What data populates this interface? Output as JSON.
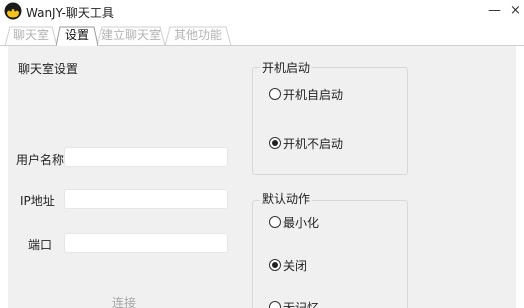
{
  "window": {
    "title": "WanJY-聊天工具",
    "minimize_glyph": "—",
    "close_glyph": "×"
  },
  "tabs": [
    {
      "label": "聊天室",
      "active": false
    },
    {
      "label": "设置",
      "active": true
    },
    {
      "label": "建立聊天室",
      "active": false
    },
    {
      "label": "其他功能",
      "active": false
    }
  ],
  "chatroom_settings": {
    "title": "聊天室设置",
    "username_label": "用户名称",
    "username_value": "",
    "ip_label": "IP地址",
    "ip_value": "",
    "port_label": "端口",
    "port_value": "",
    "connect_label": "连接"
  },
  "startup": {
    "title": "开机启动",
    "options": [
      {
        "label": "开机自启动",
        "checked": false
      },
      {
        "label": "开机不启动",
        "checked": true
      }
    ]
  },
  "default_action": {
    "title": "默认动作",
    "options": [
      {
        "label": "最小化",
        "checked": false
      },
      {
        "label": "关闭",
        "checked": true
      },
      {
        "label": "无记忆",
        "checked": false
      }
    ]
  }
}
